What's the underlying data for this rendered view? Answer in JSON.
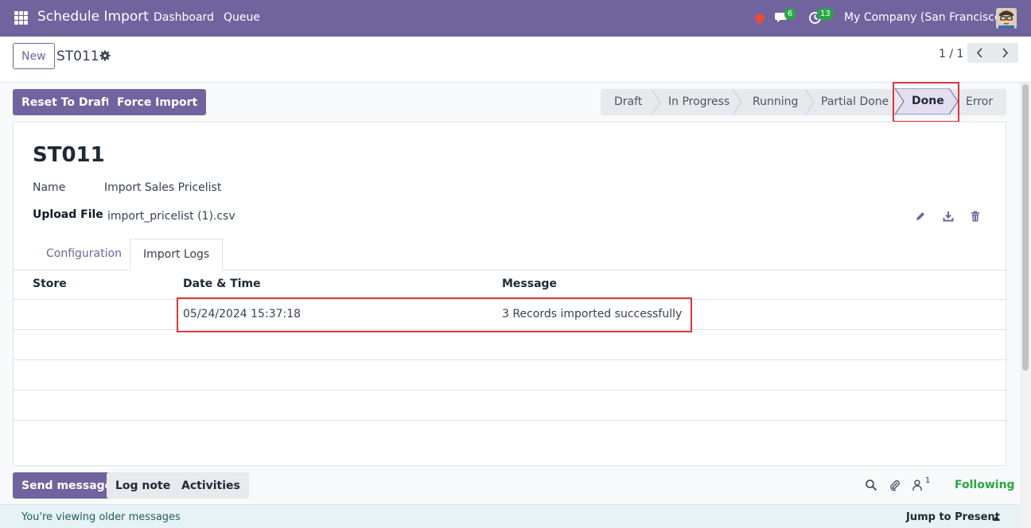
{
  "navbar": {
    "app_title": "Schedule Import",
    "links": [
      "Dashboard",
      "Queue"
    ],
    "chat_badge": "6",
    "activity_badge": "13",
    "company": "My Company (San Francisco)",
    "bg_color": "#71639e"
  },
  "control": {
    "new_label": "New",
    "record_name": "ST011",
    "pager": "1 / 1"
  },
  "statusbar": {
    "buttons": [
      "Reset To Draft",
      "Force Import"
    ],
    "stages": [
      "Draft",
      "In Progress",
      "Running",
      "Partial Done",
      "Done",
      "Error"
    ],
    "active_stage": "Done"
  },
  "form": {
    "title": "ST011",
    "name_label": "Name",
    "name_value": "Import Sales Pricelist",
    "upload_label": "Upload File",
    "upload_value": "import_pricelist (1).csv",
    "tabs": [
      "Configuration",
      "Import Logs"
    ],
    "active_tab": "Import Logs",
    "log_columns": [
      "Store",
      "Date & Time",
      "Message"
    ],
    "log_rows": [
      {
        "store": "",
        "datetime": "05/24/2024 15:37:18",
        "message": "3 Records imported successfully"
      }
    ]
  },
  "chatter": {
    "send_message": "Send message",
    "log_note": "Log note",
    "activities": "Activities",
    "followers_count": "1",
    "following": "Following",
    "older_messages": "You're viewing older messages",
    "jump_to_present": "Jump to Present"
  }
}
